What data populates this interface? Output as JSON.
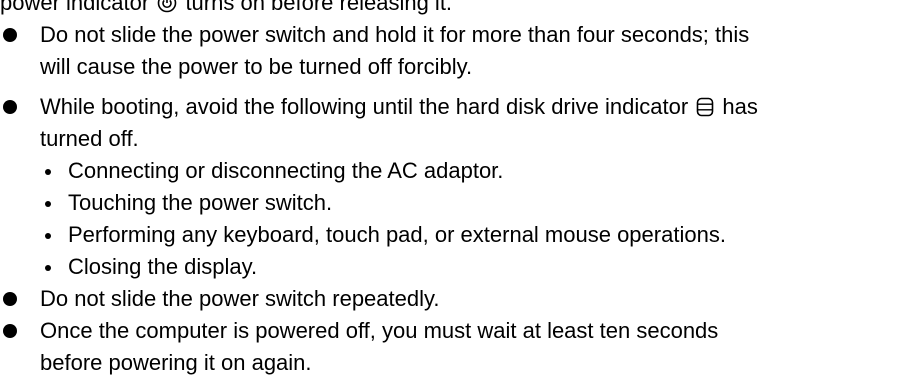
{
  "intro": {
    "before_icon": "power indicator",
    "icon": "power-indicator-icon",
    "after_icon": "turns on before releasing it."
  },
  "bullets": [
    {
      "lines": [
        "Do not slide the power switch and hold it for more than four seconds; this",
        "will cause the power to be turned off forcibly."
      ]
    },
    {
      "line1_before_icon": "While booting, avoid the following until the hard disk drive indicator",
      "icon": "hard-disk-drive-icon",
      "line1_after_icon": "has",
      "line2": "turned off.",
      "sub_items": [
        "Connecting or disconnecting the AC adaptor.",
        "Touching the power switch.",
        "Performing any keyboard, touch pad, or external mouse operations.",
        "Closing the display."
      ]
    },
    {
      "lines": [
        "Do not slide the power switch repeatedly."
      ]
    },
    {
      "lines": [
        "Once the computer is powered off, you must wait at least ten seconds",
        "before powering it on again."
      ]
    }
  ]
}
